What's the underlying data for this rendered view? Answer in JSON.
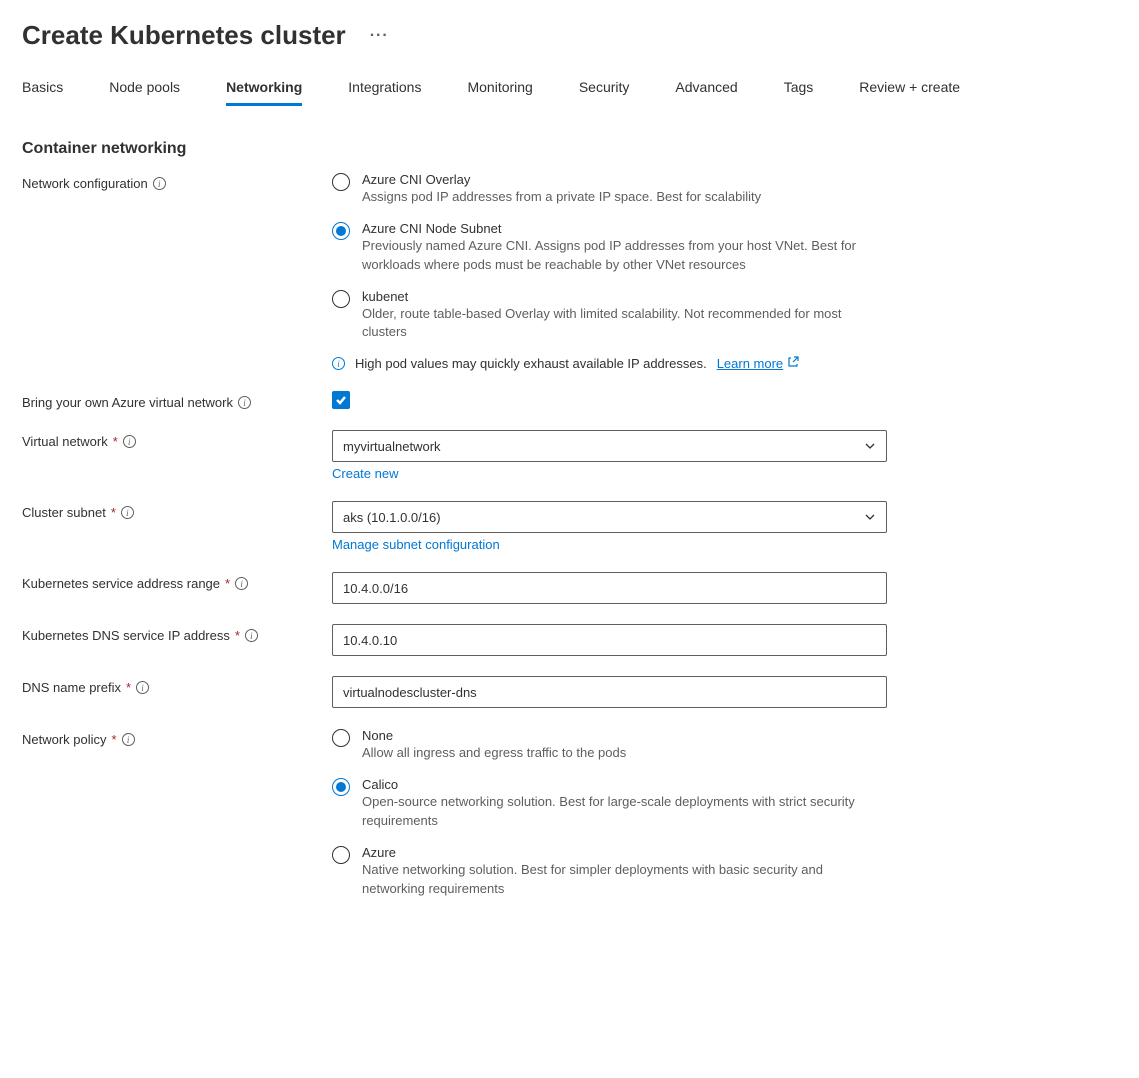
{
  "header": {
    "title": "Create Kubernetes cluster",
    "more": "···"
  },
  "tabs": [
    {
      "label": "Basics"
    },
    {
      "label": "Node pools"
    },
    {
      "label": "Networking",
      "active": true
    },
    {
      "label": "Integrations"
    },
    {
      "label": "Monitoring"
    },
    {
      "label": "Security"
    },
    {
      "label": "Advanced"
    },
    {
      "label": "Tags"
    },
    {
      "label": "Review + create"
    }
  ],
  "section": {
    "title": "Container networking"
  },
  "labels": {
    "network_config": "Network configuration",
    "byo_vnet": "Bring your own Azure virtual network",
    "vnet": "Virtual network",
    "subnet": "Cluster subnet",
    "svc_range": "Kubernetes service address range",
    "dns_ip": "Kubernetes DNS service IP address",
    "dns_prefix": "DNS name prefix",
    "net_policy": "Network policy"
  },
  "network_config": {
    "options": [
      {
        "label": "Azure CNI Overlay",
        "desc": "Assigns pod IP addresses from a private IP space. Best for scalability"
      },
      {
        "label": "Azure CNI Node Subnet",
        "desc": "Previously named Azure CNI. Assigns pod IP addresses from your host VNet. Best for workloads where pods must be reachable by other VNet resources",
        "selected": true
      },
      {
        "label": "kubenet",
        "desc": "Older, route table-based Overlay with limited scalability. Not recommended for most clusters"
      }
    ],
    "info_text": "High pod values may quickly exhaust available IP addresses.",
    "learn_more": "Learn more"
  },
  "byo_vnet": {
    "checked": true
  },
  "vnet": {
    "value": "myvirtualnetwork",
    "create_new": "Create new"
  },
  "subnet": {
    "value": "aks (10.1.0.0/16)",
    "manage": "Manage subnet configuration"
  },
  "svc_range": {
    "value": "10.4.0.0/16"
  },
  "dns_ip": {
    "value": "10.4.0.10"
  },
  "dns_prefix": {
    "value": "virtualnodescluster-dns"
  },
  "net_policy": {
    "options": [
      {
        "label": "None",
        "desc": "Allow all ingress and egress traffic to the pods"
      },
      {
        "label": "Calico",
        "desc": "Open-source networking solution. Best for large-scale deployments with strict security requirements",
        "selected": true
      },
      {
        "label": "Azure",
        "desc": "Native networking solution. Best for simpler deployments with basic security and networking requirements"
      }
    ]
  }
}
